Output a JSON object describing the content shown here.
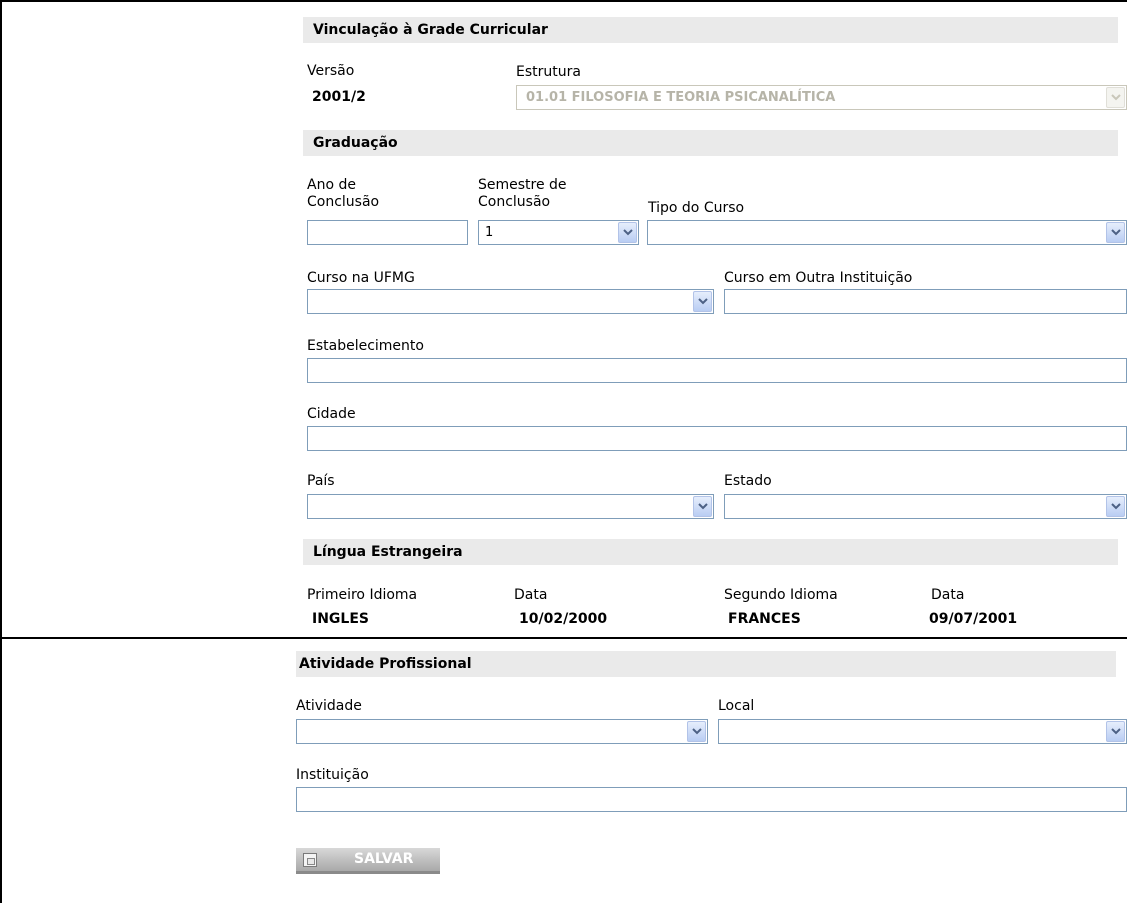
{
  "sections": {
    "grade": "Vinculação à Grade Curricular",
    "graduacao": "Graduação",
    "lingua": "Língua Estrangeira",
    "atividade": "Atividade Profissional"
  },
  "grade": {
    "versao_label": "Versão",
    "versao_value": "2001/2",
    "estrutura_label": "Estrutura",
    "estrutura_value": "01.01 FILOSOFIA E TEORIA PSICANALÍTICA"
  },
  "graduacao": {
    "ano_label_1": "Ano de",
    "ano_label_2": "Conclusão",
    "ano_value": "",
    "semestre_label_1": "Semestre de",
    "semestre_label_2": "Conclusão",
    "semestre_value": "1",
    "tipo_label": "Tipo do Curso",
    "tipo_value": "",
    "curso_ufmg_label": "Curso na UFMG",
    "curso_ufmg_value": "",
    "curso_outra_label": "Curso em Outra Instituição",
    "curso_outra_value": "",
    "estabelecimento_label": "Estabelecimento",
    "estabelecimento_value": "",
    "cidade_label": "Cidade",
    "cidade_value": "",
    "pais_label": "País",
    "pais_value": "",
    "estado_label": "Estado",
    "estado_value": ""
  },
  "lingua": {
    "primeiro_label": "Primeiro Idioma",
    "primeiro_value": "INGLES",
    "data1_label": "Data",
    "data1_value": "10/02/2000",
    "segundo_label": "Segundo Idioma",
    "segundo_value": "FRANCES",
    "data2_label": "Data",
    "data2_value": "09/07/2001"
  },
  "atividade": {
    "atividade_label": "Atividade",
    "atividade_value": "",
    "local_label": "Local",
    "local_value": "",
    "instituicao_label": "Instituição",
    "instituicao_value": ""
  },
  "actions": {
    "save_label": "SALVAR",
    "save_icon": "floppy-disk-icon"
  }
}
